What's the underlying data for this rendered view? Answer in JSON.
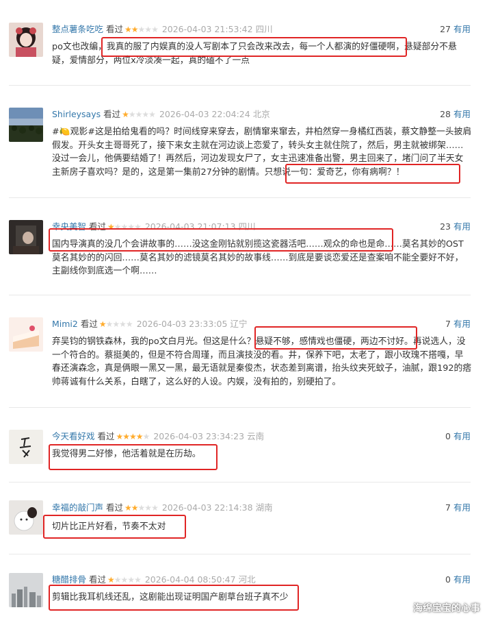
{
  "useful_label": "有用",
  "watched_label": "看过",
  "comments": [
    {
      "user": "整点薯条吃吃",
      "stars": 2,
      "time": "2026-04-03 21:53:42",
      "location": "四川",
      "votes": "27",
      "avatar_icon": "girl-avatar-icon",
      "text": "po文也改编，我真的服了内娱真的没人写剧本了只会改来改去，每一个人都演的好僵硬啊，悬疑部分不悬疑，爱情部分，两位x冷淡凑一起，真的磕不了一点"
    },
    {
      "user": "Shirleysays",
      "stars": 1,
      "time": "2026-04-03 22:04:24",
      "location": "北京",
      "votes": "28",
      "avatar_icon": "field-avatar-icon",
      "text": "#🍋观影#这是拍给鬼看的吗？时间线穿来穿去，剧情窜来窜去，井柏然穿一身橘红西装，蔡文静整一头披肩假发。开头女主哥哥死了，接下来女主就在河边谈上恋爱了，转头女主就住院了，然后，男主就被绑架……没过一会儿，他俩要结婚了！再然后，河边发现女尸了，女主迅速准备出警，男主回来了，堵门问了半天女主新房子喜欢吗？是的，这是第一集前27分钟的剧情。只想说一句：爱奇艺，你有病啊？！"
    },
    {
      "user": "幸央美智",
      "stars": 1,
      "time": "2026-04-03 21:07:13",
      "location": "四川",
      "votes": "23",
      "avatar_icon": "dark-avatar-icon",
      "text": "国内导演真的没几个会讲故事的……没这金刚钻就别揽这瓷器活吧……观众的命也是命……莫名其妙的OST莫名其妙的的闪回……莫名其妙的滤镜莫名其妙的故事线……到底是要谈恋爱还是查案咱不能全要好不好，主副线你到底选一个啊……"
    },
    {
      "user": "Mimi2",
      "stars": 1,
      "time": "2026-04-03 23:33:05",
      "location": "辽宁",
      "votes": "7",
      "avatar_icon": "cake-avatar-icon",
      "text": "弃吴钧的钢铁森林，我的po文白月光。但这是什么？悬疑不够，感情戏也僵硬，两边不讨好。再说选人，没一个符合的。蔡挺美的，但是不符合周瑾，而且演技没的看。井，保养下吧，太老了，跟小玫瑰不搭嘎，早春还演森念，真是俩眼一黑又一黑，最无语就是秦俊杰，状态差到离谱，抬头纹夹死蚊子，油腻，跟192的痞帅蒋诚有什么关系，白瞎了，这么好的人设。内娱，没有拍的，别硬拍了。"
    },
    {
      "user": "今天看好戏",
      "stars": 4,
      "time": "2026-04-03 23:34:23",
      "location": "云南",
      "votes": "0",
      "avatar_icon": "calligraphy-avatar-icon",
      "text": "我觉得男二好惨，他活着就是在历劫。"
    },
    {
      "user": "幸福的敲门声",
      "stars": 2,
      "time": "2026-04-03 22:14:38",
      "location": "湖南",
      "votes": "7",
      "avatar_icon": "plush-avatar-icon",
      "text": "切片比正片好看，节奏不太对"
    },
    {
      "user": "糖醋排骨",
      "stars": 1,
      "time": "2026-04-04 08:50:47",
      "location": "河北",
      "votes": "0",
      "avatar_icon": "city-avatar-icon",
      "text": "剪辑比我耳机线还乱，这剧能出现证明国产剧草台班子真不少"
    }
  ],
  "watermark": "海绵宝宝的心事"
}
